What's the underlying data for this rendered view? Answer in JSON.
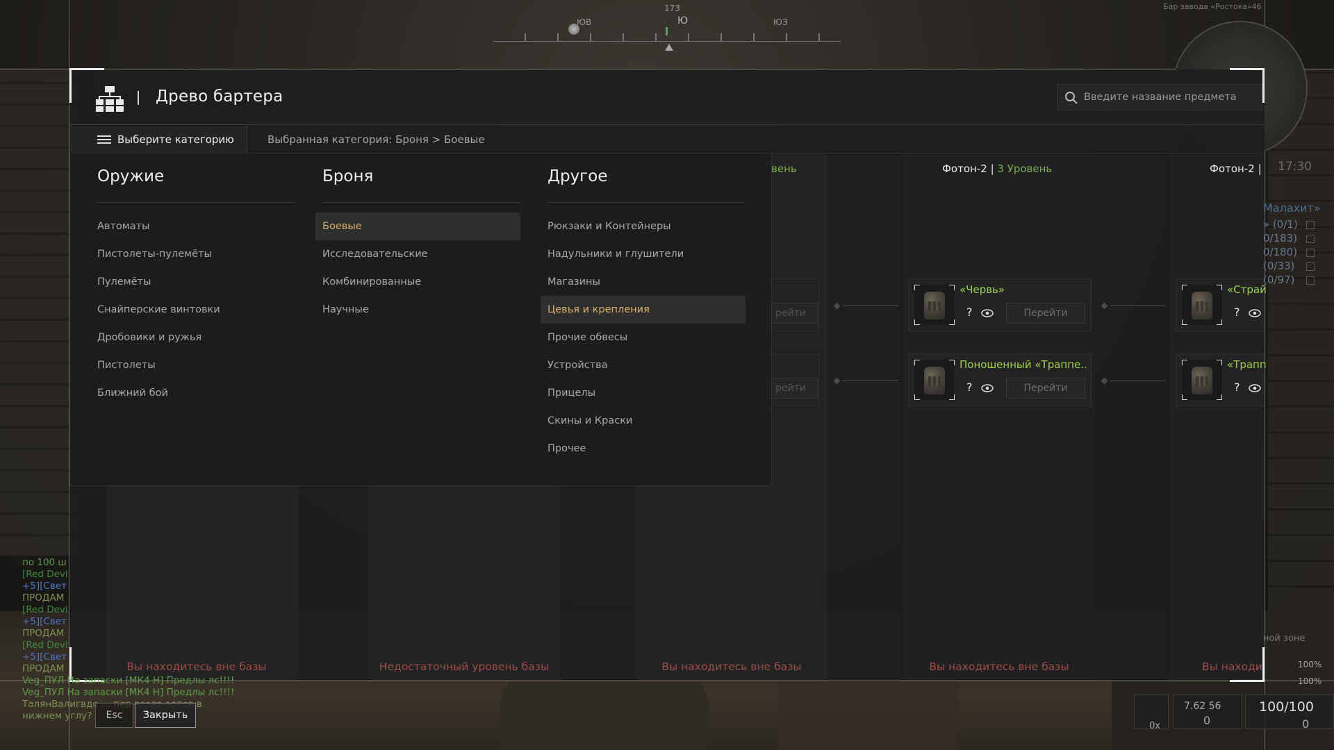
{
  "header": {
    "title": "Древо бартера",
    "search_placeholder": "Введите название предмета"
  },
  "category_bar": {
    "select_label": "Выберите категорию",
    "breadcrumb": "Выбранная категория: Броня > Боевые"
  },
  "compass": {
    "heading": "173",
    "labels": [
      "ЮВ",
      "Ю",
      "ЮЗ"
    ]
  },
  "minimap": {
    "location": "Бар завода «Ростока»46"
  },
  "time": "17:30",
  "dropdown": {
    "columns": [
      {
        "title": "Оружие",
        "items": [
          "Автоматы",
          "Пистолеты-пулемёты",
          "Пулемёты",
          "Снайперские винтовки",
          "Дробовики и ружья",
          "Пистолеты",
          "Ближний бой"
        ]
      },
      {
        "title": "Броня",
        "items": [
          "Боевые",
          "Исследовательские",
          "Комбинированные",
          "Научные"
        ]
      },
      {
        "title": "Другое",
        "items": [
          "Рюкзаки и Контейнеры",
          "Надульники и глушители",
          "Магазины",
          "Цевья и крепления",
          "Прочие обвесы",
          "Устройства",
          "Прицелы",
          "Скины и Краски",
          "Прочее"
        ]
      }
    ],
    "active_item": "Боевые",
    "hover_item": "Цевья и крепления"
  },
  "columns": [
    {
      "level_partial": "вень"
    },
    {
      "trader": "Фотон-2",
      "level": "3 Уровень"
    },
    {
      "trader": "Фотон-2",
      "sep": "|"
    }
  ],
  "cards": {
    "col4_row1": {
      "name": "«Червь»",
      "go": "Перейти",
      "q": "?"
    },
    "col4_row2": {
      "name": "Поношенный «Траппе..",
      "go": "Перейти",
      "q": "?"
    },
    "col5_row1": {
      "name": "«Страй",
      "q": "?"
    },
    "col5_row2": {
      "name": "«Трапп",
      "q": "?"
    },
    "col3_go": "рейти"
  },
  "statuses": [
    "Вы находитесь вне базы",
    "Недостаточный уровень базы",
    "Вы находитесь вне базы",
    "Вы находитесь вне базы",
    "Вы находит"
  ],
  "right_list": {
    "title": "Малахит»",
    "items": [
      "» (0/1)",
      "0/183)",
      "0/180)",
      "(0/33)",
      "(0/97)"
    ],
    "zone": "ной зоне",
    "pct1": "100%",
    "pct2": "100%"
  },
  "chat": [
    {
      "text": "по 100 ш",
      "color": "#5f9a4b"
    },
    {
      "text": "[Red Devi",
      "color": "#3f8a3f"
    },
    {
      "text": "+5][Свет",
      "color": "#4f74c9"
    },
    {
      "text": "ПРОДАМ",
      "color": "#7e8f5a"
    },
    {
      "text": "[Red Devi",
      "color": "#3f8a3f"
    },
    {
      "text": "+5][Свет",
      "color": "#4f74c9"
    },
    {
      "text": "ПРОДАМ",
      "color": "#7e8f5a"
    },
    {
      "text": "[Red Devi",
      "color": "#3f8a3f"
    },
    {
      "text": "+5][Свет",
      "color": "#4f74c9"
    },
    {
      "text": "ПРОДАМ",
      "color": "#7e8f5a"
    },
    {
      "text": "Veg_ПУЛ На запаски [МК4 Н] Предлы лс!!!!",
      "color": "#5f9a4b"
    },
    {
      "text": "Veg_ПУЛ На запаски [МК4 Н] Предлы лс!!!!",
      "color": "#5f9a4b"
    },
    {
      "text": "ТалянВалигвдо ... пер возле артов в",
      "color": "#7e8f5a"
    },
    {
      "text": "нижнем углу?",
      "color": "#7e8f5a"
    }
  ],
  "footer": {
    "esc": "Esc",
    "close": "Закрыть"
  },
  "hud": {
    "ammo_type": "7.62 56",
    "ammo_count": "0",
    "health": "100/100",
    "x_label": "0x",
    "grenades": "0"
  }
}
